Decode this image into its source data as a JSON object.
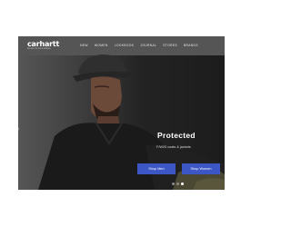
{
  "header": {
    "logo": {
      "name": "carhartt",
      "tagline": "WORK IN PROGRESS"
    },
    "nav": [
      "NEW",
      "WOMEN",
      "LOOKBOOK",
      "JOURNAL",
      "STORES",
      "BRANDS"
    ]
  },
  "hero": {
    "title": "Protected",
    "subtitle": "F/W20 coats & jackets",
    "buttons": {
      "men": "Shop Men",
      "women": "Shop Women"
    },
    "slides_total": 3,
    "active_slide": 3
  },
  "colors": {
    "button": "#3d56c6",
    "header_bg": "#555555"
  }
}
